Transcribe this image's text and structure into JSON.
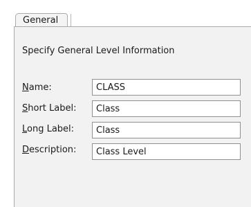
{
  "tab": {
    "label": "General"
  },
  "panel": {
    "heading": "Specify General Level Information",
    "fields": [
      {
        "mnemonic": "N",
        "rest": "ame:",
        "value": "CLASS"
      },
      {
        "mnemonic": "S",
        "rest": "hort Label:",
        "value": "Class"
      },
      {
        "mnemonic": "L",
        "rest": "ong Label:",
        "value": "Class"
      },
      {
        "mnemonic": "D",
        "rest": "escription:",
        "value": "Class Level"
      }
    ]
  }
}
